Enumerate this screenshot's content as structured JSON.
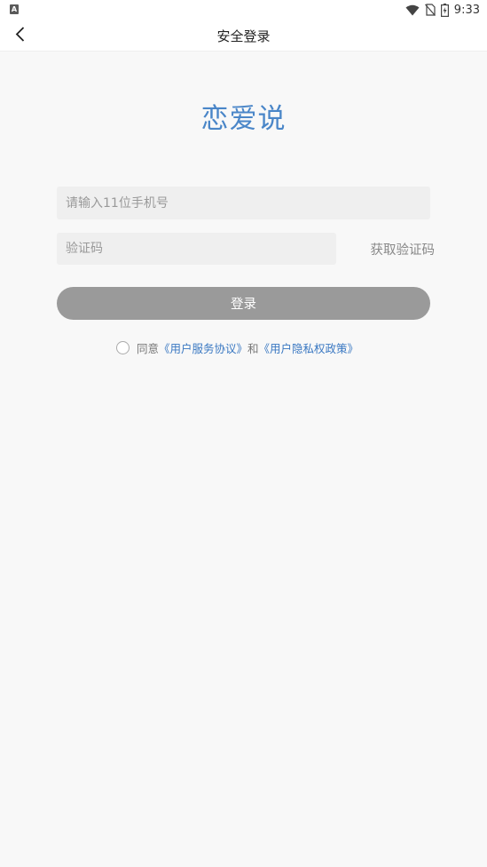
{
  "status_bar": {
    "left_icon": "A",
    "time": "9:33",
    "icons": [
      "wifi-icon",
      "no-sim-icon",
      "battery-icon"
    ]
  },
  "nav": {
    "title": "安全登录",
    "back_icon": "chevron-left-icon"
  },
  "logo_text": "恋爱说",
  "form": {
    "phone_placeholder": "请输入11位手机号",
    "code_placeholder": "验证码",
    "get_code_label": "获取验证码",
    "login_label": "登录"
  },
  "agreement": {
    "prefix": "同意",
    "user_agreement": "《用户服务协议》",
    "conjunction": "和",
    "privacy_policy": "《用户隐私权政策》",
    "checked": false
  },
  "colors": {
    "accent": "#4a86c8",
    "link": "#3a78c2",
    "button_disabled": "#9a9a9a",
    "background": "#f8f8f8"
  }
}
